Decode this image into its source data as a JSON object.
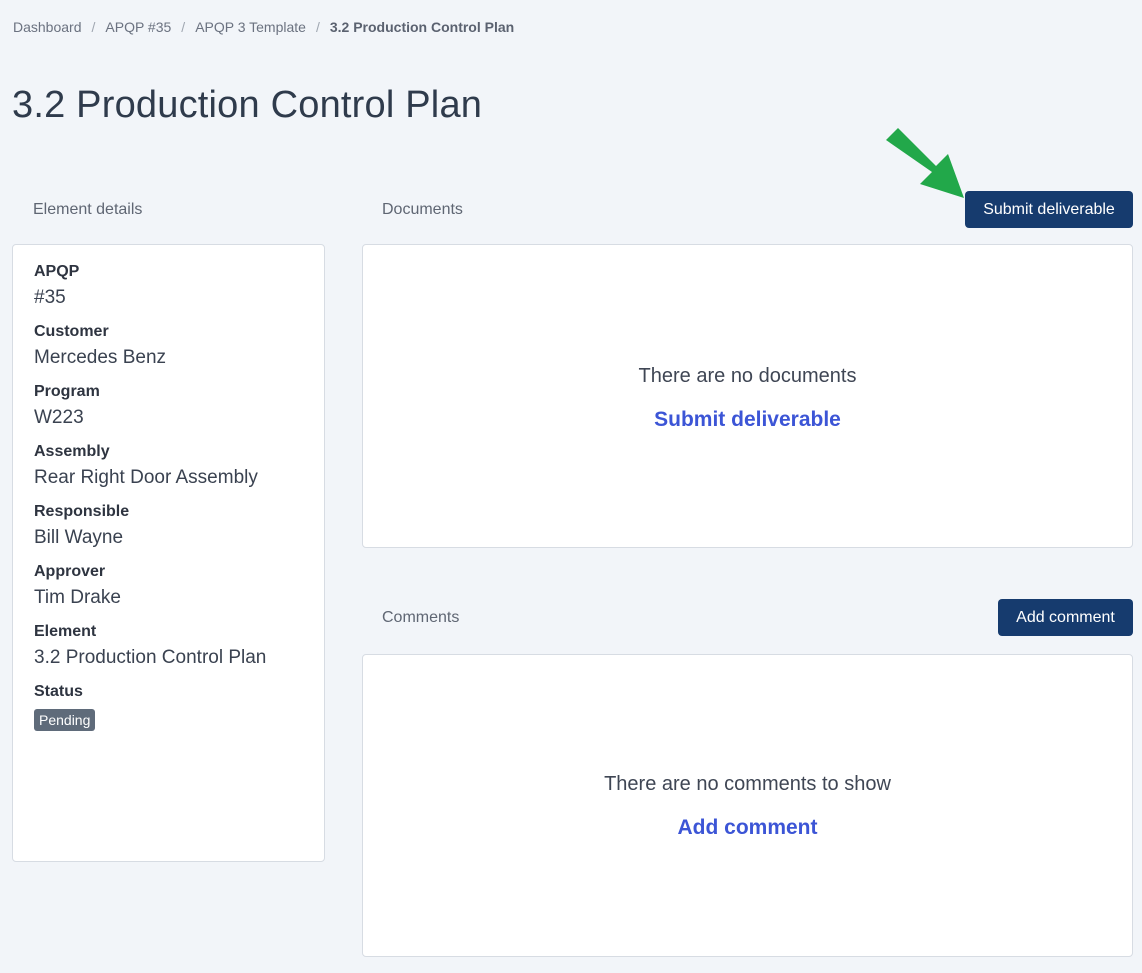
{
  "breadcrumb": {
    "items": [
      "Dashboard",
      "APQP #35",
      "APQP 3 Template"
    ],
    "current": "3.2 Production Control Plan",
    "separator": "/"
  },
  "page": {
    "title": "3.2 Production Control Plan"
  },
  "details": {
    "section_label": "Element details",
    "fields": [
      {
        "label": "APQP",
        "value": "#35"
      },
      {
        "label": "Customer",
        "value": "Mercedes Benz"
      },
      {
        "label": "Program",
        "value": "W223"
      },
      {
        "label": "Assembly",
        "value": "Rear Right Door Assembly"
      },
      {
        "label": "Responsible",
        "value": "Bill Wayne"
      },
      {
        "label": "Approver",
        "value": "Tim Drake"
      },
      {
        "label": "Element",
        "value": "3.2 Production Control Plan"
      }
    ],
    "status_label": "Status",
    "status_value": "Pending"
  },
  "documents": {
    "section_label": "Documents",
    "button_label": "Submit deliverable",
    "empty_text": "There are no documents",
    "empty_link": "Submit deliverable"
  },
  "comments": {
    "section_label": "Comments",
    "button_label": "Add comment",
    "empty_text": "There are no comments to show",
    "empty_link": "Add comment"
  },
  "colors": {
    "primary_button": "#163b6e",
    "link": "#3c55d6",
    "arrow": "#22a84a",
    "background": "#f2f5f9"
  },
  "icons": {
    "annotation_arrow": "arrow-down-right-icon"
  }
}
